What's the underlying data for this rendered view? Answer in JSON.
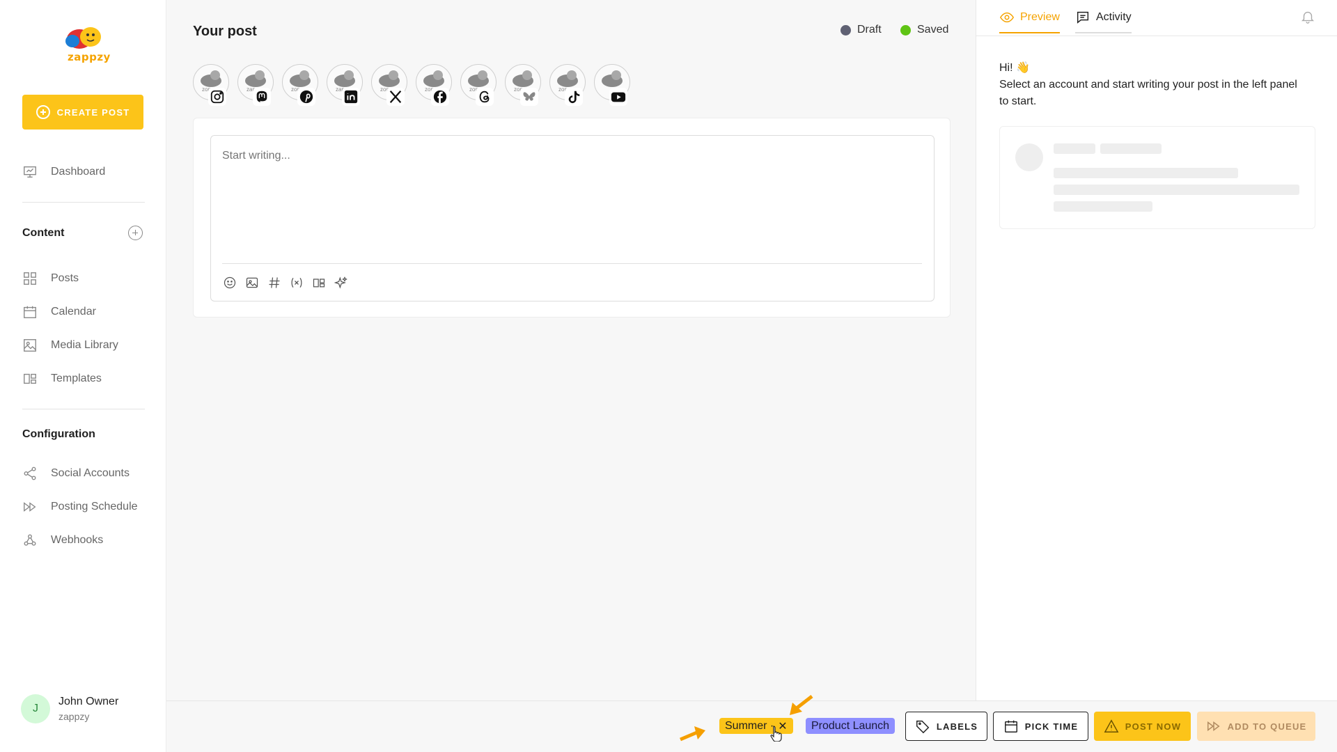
{
  "app": {
    "brand": "zappzy"
  },
  "sidebar": {
    "create_label": "CREATE POST",
    "dashboard": "Dashboard",
    "content_title": "Content",
    "content_items": [
      {
        "label": "Posts",
        "icon": "grid-icon"
      },
      {
        "label": "Calendar",
        "icon": "calendar-icon"
      },
      {
        "label": "Media Library",
        "icon": "image-icon"
      },
      {
        "label": "Templates",
        "icon": "templates-icon"
      }
    ],
    "config_title": "Configuration",
    "config_items": [
      {
        "label": "Social Accounts",
        "icon": "share-icon"
      },
      {
        "label": "Posting Schedule",
        "icon": "fast-forward-icon"
      },
      {
        "label": "Webhooks",
        "icon": "webhook-icon"
      }
    ],
    "user": {
      "initial": "J",
      "name": "John Owner",
      "org": "zappzy"
    }
  },
  "main": {
    "title": "Your post",
    "status": [
      {
        "label": "Draft",
        "color": "#5f6173"
      },
      {
        "label": "Saved",
        "color": "#5fc414"
      }
    ],
    "accounts": [
      "instagram",
      "mastodon",
      "pinterest",
      "linkedin",
      "x",
      "facebook",
      "threads",
      "bluesky",
      "tiktok",
      "youtube"
    ],
    "editor": {
      "placeholder": "Start writing...",
      "tools": [
        "emoji-icon",
        "image-icon",
        "hashtag-icon",
        "variable-icon",
        "template-icon",
        "sparkle-icon"
      ]
    }
  },
  "preview": {
    "tabs": [
      {
        "label": "Preview",
        "icon": "eye-icon",
        "active": true
      },
      {
        "label": "Activity",
        "icon": "comment-icon",
        "active": false
      }
    ],
    "greeting": "Hi! 👋",
    "message": "Select an account and start writing your post in the left panel to start."
  },
  "footer": {
    "labels": [
      {
        "label": "Summer ·",
        "color": "#fcc419"
      },
      {
        "label": "Product Launch",
        "color": "#8e8fff"
      }
    ],
    "buttons": {
      "labels": "LABELS",
      "pick_time": "PICK TIME",
      "post_now": "POST NOW",
      "add_to_queue": "ADD TO QUEUE"
    }
  },
  "colors": {
    "accent": "#fcc419",
    "accent_text": "#f5a300"
  }
}
